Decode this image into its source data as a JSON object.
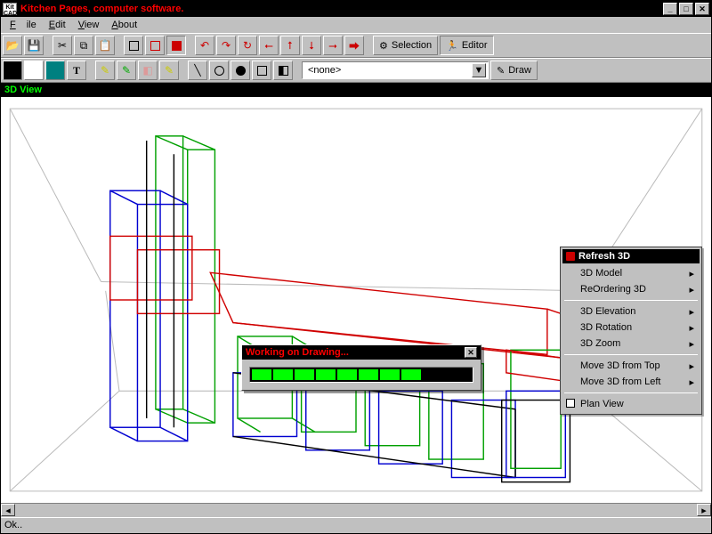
{
  "app": {
    "title": "Kitchen Pages, computer software.",
    "icon_text": "Kit CAD"
  },
  "menubar": {
    "file": "File",
    "edit": "Edit",
    "view": "View",
    "about": "About"
  },
  "toolbar1": {
    "selection": "Selection",
    "editor": "Editor"
  },
  "toolbar2": {
    "combo_value": "<none>",
    "draw": "Draw"
  },
  "view": {
    "title": "3D View"
  },
  "context_menu": {
    "title": "Refresh 3D",
    "items": {
      "model": "3D Model",
      "reorder": "ReOrdering 3D",
      "elev": "3D Elevation",
      "rot": "3D Rotation",
      "zoom": "3D Zoom",
      "movetop": "Move 3D from Top",
      "moveleft": "Move 3D from Left",
      "planview": "Plan View"
    }
  },
  "dialog": {
    "title": "Working on Drawing...",
    "progress_segments": 8
  },
  "swatches": {
    "c0": "#000000",
    "c1": "#ffffff",
    "c2": "#008080",
    "c3": "#ffff00"
  },
  "status": {
    "text": "Ok.."
  }
}
